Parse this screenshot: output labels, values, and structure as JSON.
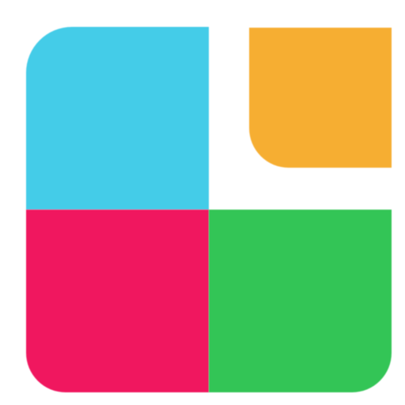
{
  "logo": {
    "name": "four-tile-logo",
    "colors": {
      "blue": "#44cce8",
      "orange": "#f6ae32",
      "magenta": "#f0175f",
      "green": "#33c556"
    }
  }
}
